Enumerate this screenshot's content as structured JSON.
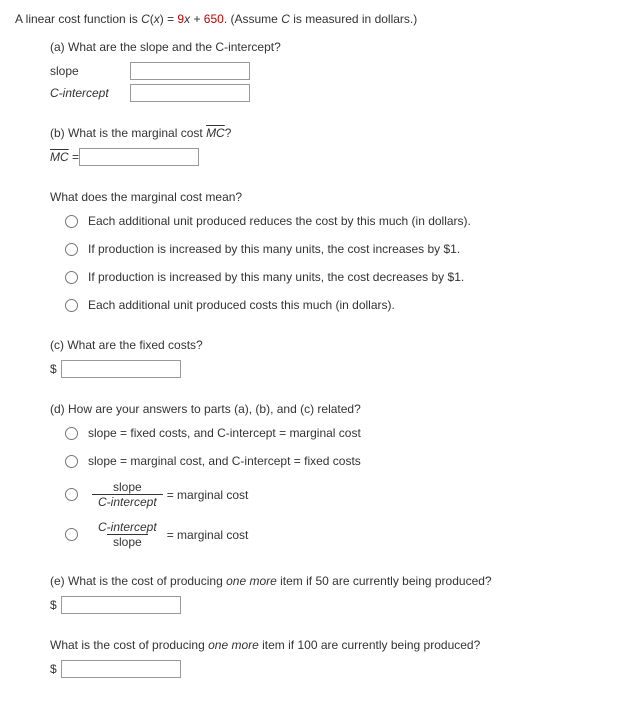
{
  "intro_prefix": "A linear cost function is ",
  "intro_func": "C",
  "intro_open": "(",
  "intro_x": "x",
  "intro_close": ") = ",
  "intro_coef": "9",
  "intro_xvar": "x",
  "intro_plus": " + ",
  "intro_const": "650",
  "intro_suffix1": ". (Assume ",
  "intro_cvar": "C",
  "intro_suffix2": " is measured in dollars.)",
  "a": {
    "question": "(a) What are the slope and the C-intercept?",
    "slope_label": "slope",
    "cint_label": "C-intercept"
  },
  "b": {
    "q_prefix": "(b) What is the marginal cost ",
    "mc": "MC",
    "q_suffix": "?",
    "eq_lhs": "MC",
    "eq_mid": " = ",
    "meaning_q": "What does the marginal cost mean?",
    "opt1": "Each additional unit produced reduces the cost by this much (in dollars).",
    "opt2": "If production is increased by this many units, the cost increases by $1.",
    "opt3": "If production is increased by this many units, the cost decreases by $1.",
    "opt4": "Each additional unit produced costs this much (in dollars)."
  },
  "c": {
    "question": "(c) What are the fixed costs?",
    "dollar": "$"
  },
  "d": {
    "question": "(d) How are your answers to parts (a), (b), and (c) related?",
    "opt1": "slope = fixed costs, and C-intercept = marginal cost",
    "opt2": "slope = marginal cost, and C-intercept = fixed costs",
    "opt3_num": "slope",
    "opt3_den": "C-intercept",
    "opt3_rhs": " = marginal cost",
    "opt4_num": "C-intercept",
    "opt4_den": "slope",
    "opt4_rhs": " = marginal cost"
  },
  "e": {
    "q1_prefix": "(e) What is the cost of producing ",
    "q1_em": "one more",
    "q1_suffix": " item if 50 are currently being produced?",
    "dollar": "$",
    "q2_prefix": "What is the cost of producing ",
    "q2_em": "one more",
    "q2_suffix": " item if 100 are currently being produced?"
  }
}
